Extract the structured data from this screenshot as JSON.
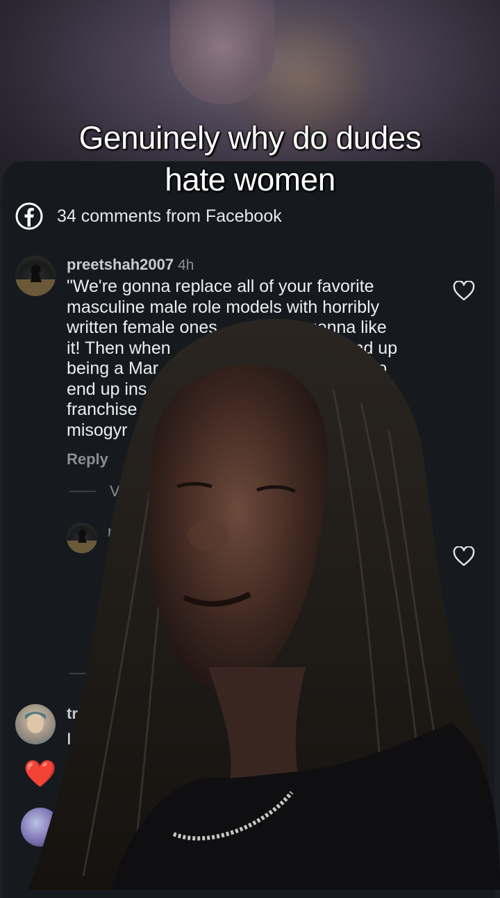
{
  "overlay_caption": [
    "Genuinely why do dudes",
    "hate women"
  ],
  "comments_header": {
    "icon": "facebook-icon",
    "text": "34 comments from Facebook"
  },
  "comments": [
    {
      "username": "preetshah2007",
      "time": "4h",
      "text_lines": [
        "\"We're gonna replace all of your favorite",
        "masculine male role models with horribly",
        "written female ones",
        "it! Then when",
        "being a Mar",
        "end up ins",
        "franchise",
        "misogyr"
      ],
      "text_right_fragments": [
        "gonna like",
        "end up",
        "ing to"
      ],
      "reply_label": "Reply",
      "view_replies_label": "V",
      "reply_author_initial": "r"
    },
    {
      "username": "tr",
      "text": "I",
      "reaction": "❤️"
    }
  ],
  "colors": {
    "panel_bg": "#161a1f",
    "text_primary": "#eceef0",
    "text_muted": "#8b8f95",
    "heart_red": "#e22134"
  }
}
